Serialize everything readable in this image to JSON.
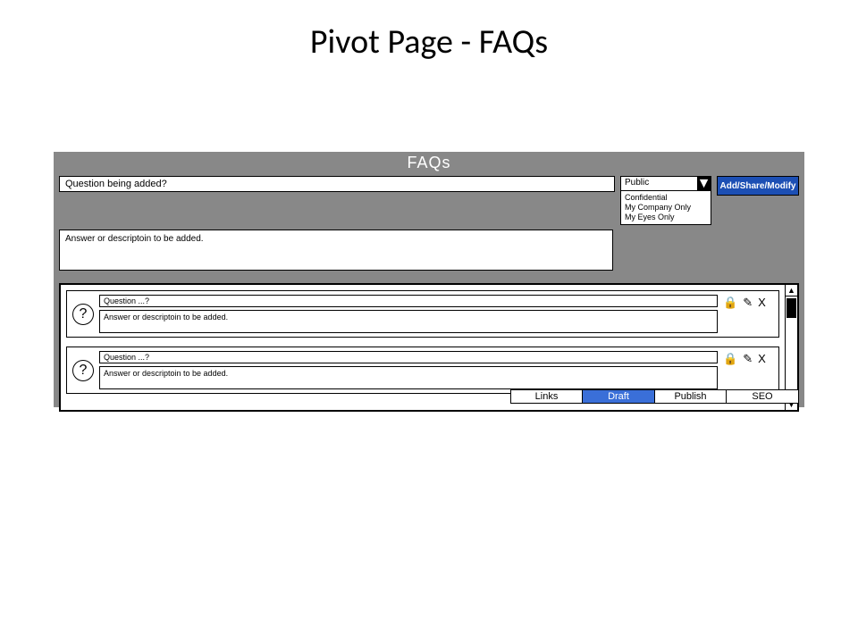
{
  "slide_title": "Pivot Page - FAQs",
  "panel_title": "FAQs",
  "add": {
    "question_placeholder": "Question being added?",
    "answer_placeholder": "Answer or descriptoin to be added.",
    "visibility_selected": "Public",
    "visibility_options": [
      "Confidential",
      "My Company Only",
      "My Eyes Only"
    ],
    "button_label": "Add/Share/Modify"
  },
  "rows": [
    {
      "question": "Question ...?",
      "answer": "Answer or descriptoin to be added."
    },
    {
      "question": "Question ...?",
      "answer": "Answer or descriptoin to be added."
    }
  ],
  "tabs": {
    "items": [
      "Links",
      "Draft",
      "Publish",
      "SEO"
    ],
    "active": "Draft"
  },
  "icons": {
    "question": "?",
    "lock": "🔒",
    "edit": "✎",
    "delete": "X",
    "tri_down": "▼",
    "tri_up": "▲"
  }
}
